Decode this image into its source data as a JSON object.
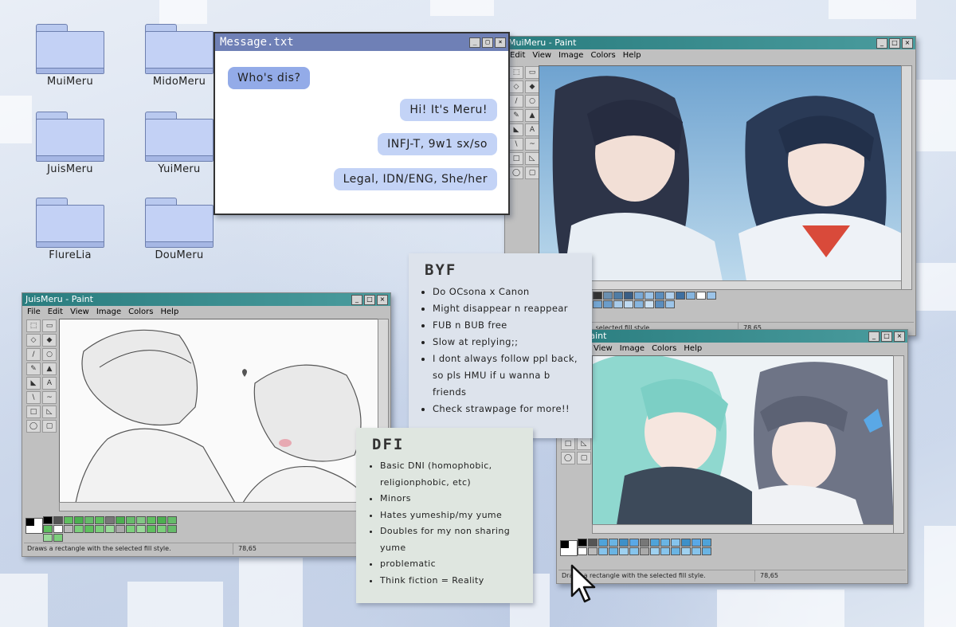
{
  "desktop": {
    "folders": [
      {
        "label": "MuiMeru"
      },
      {
        "label": "MidoMeru"
      },
      {
        "label": "JuisMeru"
      },
      {
        "label": "YuiMeru"
      },
      {
        "label": "FlureLia"
      },
      {
        "label": "DouMeru"
      }
    ]
  },
  "message_window": {
    "title": "Message.txt",
    "messages": [
      {
        "text": "Who's dis?",
        "side": "left"
      },
      {
        "text": "Hi! It's Meru!",
        "side": "right"
      },
      {
        "text": "INFJ-T, 9w1 sx/so",
        "side": "right"
      },
      {
        "text": "Legal, IDN/ENG, She/her",
        "side": "right"
      }
    ]
  },
  "paint_windows": {
    "top_right": {
      "title": "MuiMeru - Paint"
    },
    "left": {
      "title": "JuisMeru - Paint",
      "status": "Draws a rectangle with the selected fill style.",
      "coords": "78,65"
    },
    "bottom_right": {
      "title": "...ia - Paint",
      "status": "Draws a rectangle with the selected fill style.",
      "coords": "78,65"
    },
    "top_right_status": {
      "status": "...selected fill style",
      "coords": "78,65"
    },
    "menu": [
      "File",
      "Edit",
      "View",
      "Image",
      "Colors",
      "Help"
    ],
    "menu_partial": [
      "View",
      "Image",
      "Colors",
      "Help"
    ]
  },
  "byf_note": {
    "title": "BYF",
    "items": [
      "Do OCsona x Canon",
      "Might disappear n reappear",
      "FUB n BUB free",
      "Slow at replying;;",
      "I dont always follow ppl back, so pls HMU if u wanna b friends",
      "Check strawpage for more!!"
    ]
  },
  "dni_note": {
    "title": "DFI",
    "items": [
      "Basic DNI (homophobic, religionphobic, etc)",
      "Minors",
      "Hates yumeship/my yume",
      "Doubles for my non sharing yume",
      "problematic",
      "Think fiction = Reality"
    ]
  },
  "colors": {
    "titlebar": "#2a7d7f",
    "message_titlebar": "#6f80b6",
    "bubble_left": "#93abe8",
    "bubble_right": "#c3d3f6",
    "folder": "#c3d1f5"
  },
  "icons": [
    "folder-icon",
    "minimize-icon",
    "maximize-icon",
    "close-icon",
    "cursor-arrow-icon"
  ]
}
